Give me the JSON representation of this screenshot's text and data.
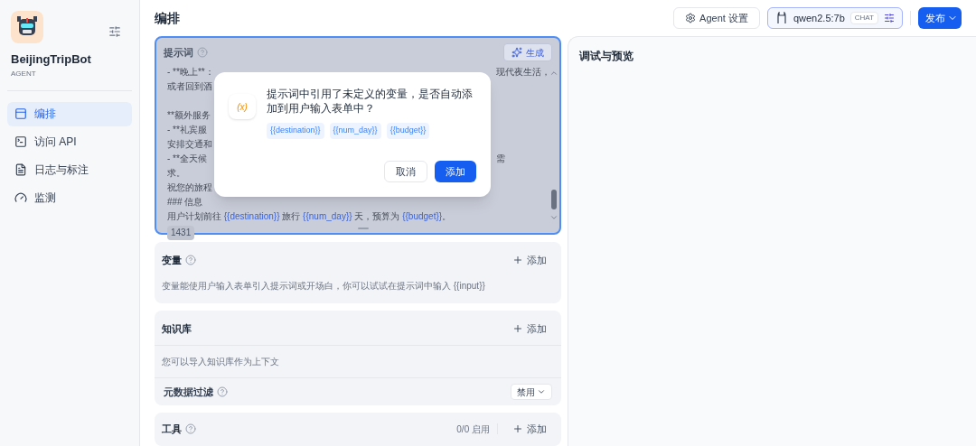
{
  "sidebar": {
    "app_name": "BeijingTripBot",
    "app_type": "AGENT",
    "items": [
      {
        "label": "编排",
        "selected": true
      },
      {
        "label": "访问 API",
        "selected": false
      },
      {
        "label": "日志与标注",
        "selected": false
      },
      {
        "label": "监测",
        "selected": false
      }
    ]
  },
  "header": {
    "title": "编排",
    "agent_settings": "Agent 设置",
    "model": {
      "name": "qwen2.5:7b",
      "badge": "CHAT"
    },
    "publish": "发布"
  },
  "prompt": {
    "title": "提示词",
    "generate": "生成",
    "lines": [
      {
        "kind": "text",
        "left": "- **晚上**：",
        "right": "现代夜生活，"
      },
      {
        "kind": "text",
        "left": "或者回到酒"
      },
      {
        "kind": "blank"
      },
      {
        "kind": "text",
        "left": "**额外服务"
      },
      {
        "kind": "text",
        "left": "- **礼宾服"
      },
      {
        "kind": "text",
        "left": "安排交通和"
      },
      {
        "kind": "text",
        "left": "- **全天候",
        "right": "需"
      },
      {
        "kind": "text",
        "left": "求。"
      },
      {
        "kind": "text",
        "left": "祝您的旅程"
      },
      {
        "kind": "text",
        "left": "### 信息"
      },
      {
        "kind": "segments",
        "segments": [
          {
            "kind": "text",
            "text": "用户计划前往 "
          },
          {
            "kind": "variable",
            "text": "{{destination}}"
          },
          {
            "kind": "text",
            "text": " 旅行 "
          },
          {
            "kind": "variable",
            "text": "{{num_day}}"
          },
          {
            "kind": "text",
            "text": " 天，预算为 "
          },
          {
            "kind": "variable",
            "text": "{{budget}}"
          },
          {
            "kind": "text",
            "text": "。"
          }
        ]
      }
    ],
    "count": "1431"
  },
  "dialog": {
    "icon": "(x)",
    "message": "提示词中引用了未定义的变量，是否自动添加到用户输入表单中？",
    "variables": [
      "{{destination}}",
      "{{num_day}}",
      "{{budget}}"
    ],
    "cancel": "取消",
    "confirm": "添加"
  },
  "variables": {
    "title": "变量",
    "add": "添加",
    "description": "变量能使用户输入表单引入提示词或开场白，你可以试试在提示词中输入 {{input}}"
  },
  "knowledge": {
    "title": "知识库",
    "add": "添加",
    "description": "您可以导入知识库作为上下文",
    "filter_label": "元数据过滤",
    "filter_value": "禁用"
  },
  "tools": {
    "title": "工具",
    "status": "0/0 启用",
    "add": "添加"
  },
  "preview": {
    "title": "调试与预览"
  }
}
